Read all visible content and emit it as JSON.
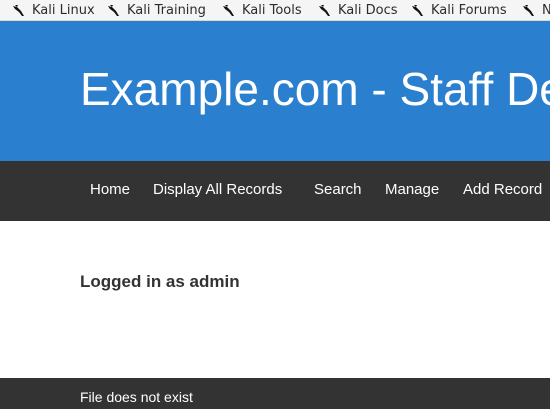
{
  "bookmarks": [
    {
      "label": "Kali Linux",
      "icon": "kali-dragon-icon"
    },
    {
      "label": "Kali Training",
      "icon": "kali-dragon-icon"
    },
    {
      "label": "Kali Tools",
      "icon": "kali-dragon-icon"
    },
    {
      "label": "Kali Docs",
      "icon": "kali-dragon-icon"
    },
    {
      "label": "Kali Forums",
      "icon": "kali-dragon-icon"
    },
    {
      "label": "N",
      "icon": "kali-dragon-icon"
    }
  ],
  "header": {
    "title": "Example.com - Staff Details"
  },
  "nav": {
    "items": [
      {
        "label": "Home"
      },
      {
        "label": "Display All Records"
      },
      {
        "label": "Search"
      },
      {
        "label": "Manage"
      },
      {
        "label": "Add Record"
      }
    ]
  },
  "main": {
    "logged_in_text": "Logged in as admin"
  },
  "footer": {
    "status_text": "File does not exist"
  },
  "colors": {
    "header_bg": "#2b7fcf",
    "nav_bg": "#333333",
    "footer_bg": "#333333",
    "bookmarks_bg": "#f5f5f5"
  }
}
